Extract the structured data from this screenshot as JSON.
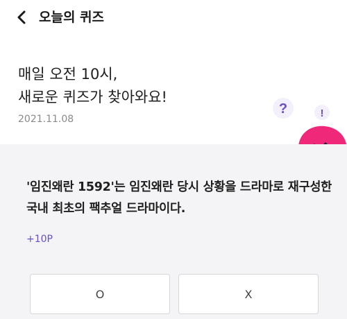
{
  "header": {
    "back_icon": "chevron-left-icon",
    "title": "오늘의 퀴즈"
  },
  "intro": {
    "line1": "매일 오전 10시,",
    "line2": "새로운 퀴즈가 찾아와요!",
    "date": "2021.11.08",
    "mascot": {
      "question_mark": "?",
      "exclamation_mark": "!",
      "body_color": "#f0287a",
      "mark_color": "#6a4fc4"
    }
  },
  "quiz": {
    "question": "'임진왜란 1592'는 임진왜란 당시 상황을 드라마로 재구성한 국내 최초의 팩추얼 드라마이다.",
    "reward": "+10P",
    "options": {
      "o_label": "O",
      "x_label": "X"
    }
  },
  "colors": {
    "accent": "#6a4fc4",
    "quiz_background": "#f4f4f6",
    "mascot": "#f0287a"
  }
}
